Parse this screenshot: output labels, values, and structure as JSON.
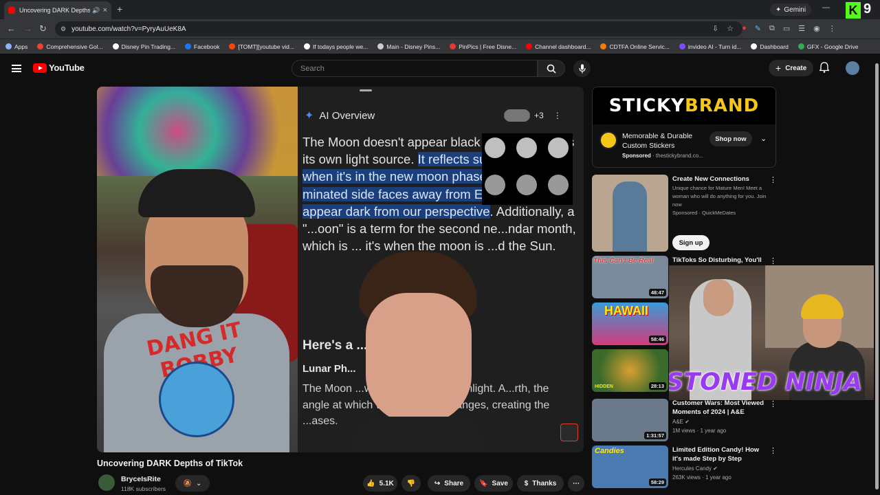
{
  "browser": {
    "tab_title": "Uncovering DARK Depths o",
    "tab_close": "×",
    "new_tab": "+",
    "url": "youtube.com/watch?v=PyryAuUeK8A",
    "gemini_label": "Gemini",
    "profile_number": "9",
    "kick_letter": "K",
    "bookmarks": [
      {
        "label": "Apps",
        "color": "#8ab4f8"
      },
      {
        "label": "Comprehensive Gol...",
        "color": "#ea4335"
      },
      {
        "label": "Disney Pin Trading...",
        "color": "#ffffff"
      },
      {
        "label": "Facebook",
        "color": "#1877f2"
      },
      {
        "label": "[TOMT][youtube vid...",
        "color": "#ff4500"
      },
      {
        "label": "If todays people we...",
        "color": "#ffffff"
      },
      {
        "label": "Main - Disney Pins...",
        "color": "#cccccc"
      },
      {
        "label": "PinPics | Free Disne...",
        "color": "#e53935"
      },
      {
        "label": "Channel dashboard...",
        "color": "#ff0000"
      },
      {
        "label": "CDTFA Online Servic...",
        "color": "#f57c00"
      },
      {
        "label": "invideo AI - Turn id...",
        "color": "#7c4dff"
      },
      {
        "label": "Dashboard",
        "color": "#ffffff"
      },
      {
        "label": "GFX - Google Drive",
        "color": "#34a853"
      }
    ]
  },
  "youtube": {
    "logo_text": "YouTube",
    "search_placeholder": "Search",
    "create_label": "Create"
  },
  "video": {
    "ai_overview_label": "AI Overview",
    "ai_plus": "+3",
    "ai_para_plain": "The Moon doesn't appear black because it lacks its own light source. ",
    "ai_para_highlight": "It reflects sunlight, and when it's in the new moon phase, the illu-minated side faces away from Earth, mak-ing it appear dark from our perspective",
    "ai_para_tail": ". Additionally, a \"...oon\" is a term for the second ne...ndar month, which is ... it's when the moon is ...d the Sun.",
    "ai_heading": "Here's a ...nation:",
    "ai_subheading": "Lunar Ph...",
    "ai_para2": "The Moon ...wn light; it reflects sunlight. A...rth, the angle at which we s...portion changes, creating the ...ases.",
    "shirt_text": "DANG IT BOBBY",
    "title": "Uncovering DARK Depths of TikTok",
    "channel_name": "BryceIsRite",
    "channel_subs": "118K subscribers",
    "likes": "5.1K",
    "share_label": "Share",
    "save_label": "Save",
    "thanks_label": "Thanks"
  },
  "ad": {
    "brand_white": "STICKY ",
    "brand_yellow": "BRAND",
    "title": "Memorable & Durable Custom Stickers",
    "sponsored": "Sponsored",
    "domain": " · thestickybrand.co...",
    "cta": "Shop now"
  },
  "recommendations": [
    {
      "title": "Create New Connections",
      "meta1": "Unique chance for Mature Men! Meet a woman who will do anything for you. Join now",
      "meta2": "Sponsored · QuickMeDates",
      "cta": "Sign up",
      "thumb_color": "#b9a690"
    },
    {
      "title": "TikToks So Disturbing, You'll",
      "duration": "48:47",
      "thumb_color": "#7a8a9a",
      "thumb_text": "This Can't Be Real"
    },
    {
      "title": "",
      "duration": "58:46",
      "thumb_color": "#d43a7a",
      "thumb_text": "HAWAII"
    },
    {
      "title": "",
      "duration": "28:13",
      "thumb_color": "#3a6a2a",
      "thumb_text": "HIDDEN"
    },
    {
      "title": "Customer Wars: Most Viewed Moments of 2024 | A&E",
      "channel": "A&E",
      "meta": "1M views · 1 year ago",
      "duration": "1:31:57",
      "thumb_color": "#6a7a8a"
    },
    {
      "title": "Limited Edition Candy! How it's made Step by Step",
      "channel": "Hercules Candy",
      "meta": "263K views · 1 year ago",
      "duration": "58:29",
      "thumb_color": "#4a7ab0",
      "thumb_text": "Candies"
    }
  ],
  "overlay": {
    "stream_text": "STONED NINJA"
  }
}
